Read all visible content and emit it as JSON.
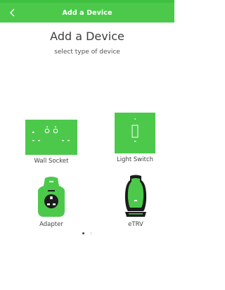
{
  "header": {
    "title": "Add a Device",
    "back_icon": "chevron-left-icon"
  },
  "main": {
    "title": "Add a Device",
    "subtitle": "select type of device"
  },
  "devices": [
    {
      "label": "Wall Socket",
      "icon": "wall-socket-icon"
    },
    {
      "label": "Light Switch",
      "icon": "light-switch-icon"
    },
    {
      "label": "Adapter",
      "icon": "adapter-icon"
    },
    {
      "label": "eTRV",
      "icon": "etrv-icon"
    }
  ],
  "pager": {
    "total_pages": 2,
    "current_page": 1
  },
  "colors": {
    "brand_green": "#4cc94b",
    "status_green": "#3fc140",
    "dark": "#1c1c1c"
  }
}
